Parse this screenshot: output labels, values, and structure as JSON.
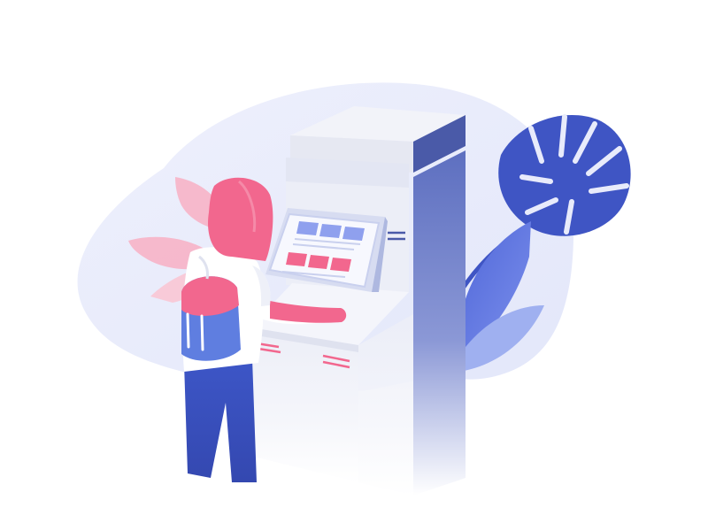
{
  "scene": {
    "subject": "person-using-kiosk",
    "colors": {
      "background": "#ffffff",
      "blob": "#e8ebfb",
      "kiosk_light": "#f4f5fb",
      "kiosk_mid": "#e3e6f3",
      "kiosk_dark": "#4a5aa8",
      "kiosk_side": "#6a7bc4",
      "screen_frame": "#c9d0ee",
      "screen_bg": "#f7f8fe",
      "screen_tile_blue": "#8fa0ee",
      "screen_tile_pink": "#f2678e",
      "accent_pink": "#f2678e",
      "pants_blue": "#3d56c7",
      "leaf_dark": "#3f55c4",
      "leaf_mid": "#5f76e0",
      "leaf_light": "#9fb0f0",
      "pink_leaf": "#f7b3c6"
    }
  }
}
